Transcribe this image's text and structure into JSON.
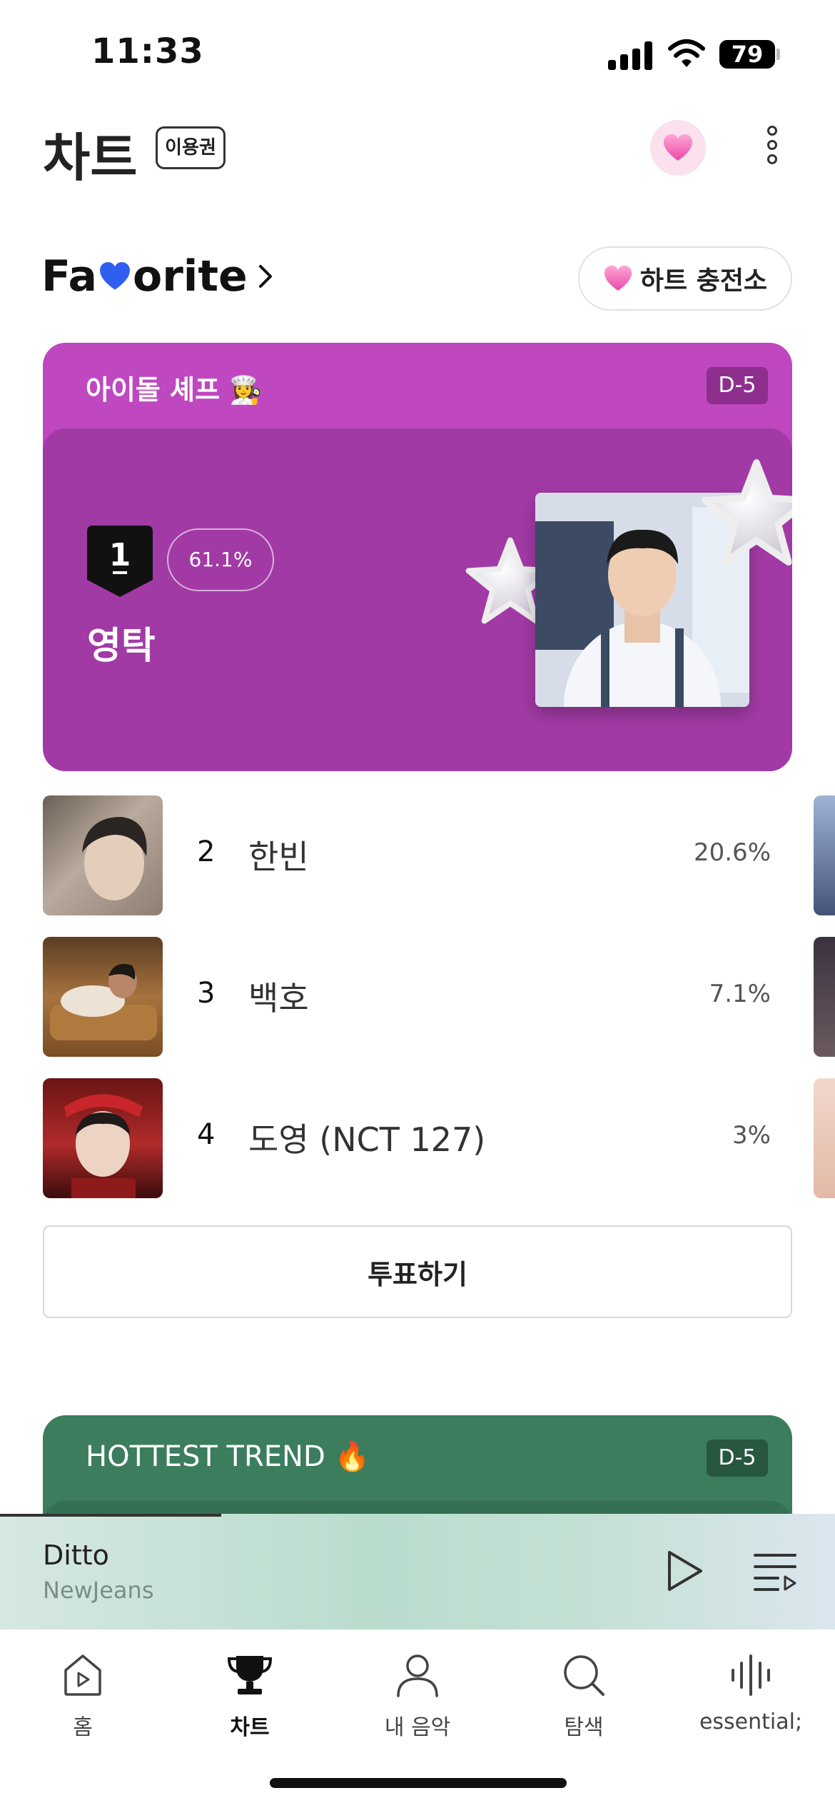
{
  "status_bar": {
    "time": "11:33",
    "battery": "79"
  },
  "header": {
    "title": "차트",
    "pass_badge": "이용권"
  },
  "favorite": {
    "title_pre": "Fa",
    "title_post": "orite",
    "charge_button": "하트 충전소"
  },
  "vote_card": {
    "title": "아이돌 셰프 👩‍🍳",
    "dday": "D-5",
    "winner": {
      "rank": "1",
      "percent": "61.1%",
      "name": "영탁"
    },
    "colors": {
      "card": "#bf47bf",
      "inner": "#a23aa6"
    }
  },
  "ranking": [
    {
      "rank": "2",
      "name": "한빈",
      "percent": "20.6%"
    },
    {
      "rank": "3",
      "name": "백호",
      "percent": "7.1%"
    },
    {
      "rank": "4",
      "name": "도영 (NCT 127)",
      "percent": "3%"
    }
  ],
  "vote_button": "투표하기",
  "trend_card": {
    "title": "HOTTEST TREND 🔥",
    "dday": "D-5",
    "color": "#3c7d5e"
  },
  "player": {
    "title": "Ditto",
    "artist": "NewJeans"
  },
  "bottom_nav": [
    {
      "label": "홈",
      "icon": "home-play-icon"
    },
    {
      "label": "차트",
      "icon": "trophy-icon",
      "active": true
    },
    {
      "label": "내 음악",
      "icon": "person-icon"
    },
    {
      "label": "탐색",
      "icon": "search-icon"
    },
    {
      "label": "essential;",
      "icon": "waveform-icon"
    }
  ]
}
